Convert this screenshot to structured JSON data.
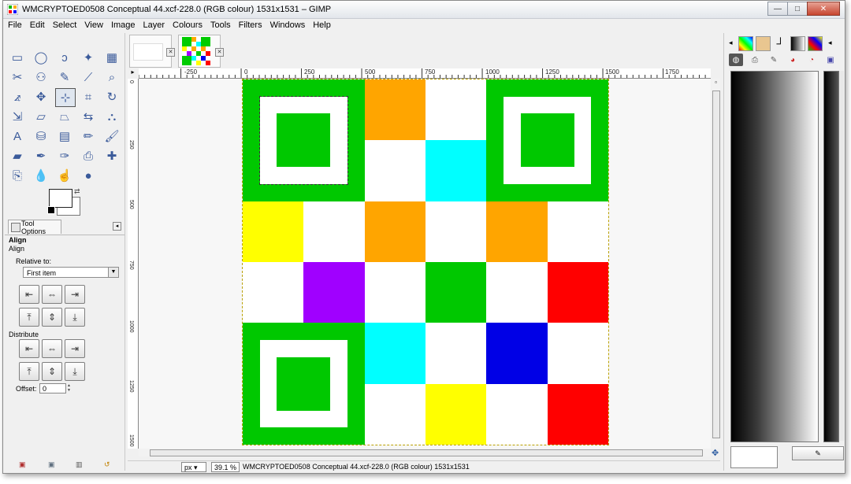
{
  "window": {
    "title": "WMCRYPTOED0508 Conceptual 44.xcf-228.0 (RGB colour) 1531x1531 – GIMP",
    "buttons": {
      "minimize": "—",
      "maximize": "□",
      "close": "✕"
    }
  },
  "menubar": {
    "items": [
      "File",
      "Edit",
      "Select",
      "View",
      "Image",
      "Layer",
      "Colours",
      "Tools",
      "Filters",
      "Windows",
      "Help"
    ]
  },
  "toolbox": {
    "tools": [
      {
        "name": "rect-select-icon",
        "glyph": "▭"
      },
      {
        "name": "ellipse-select-icon",
        "glyph": "◯"
      },
      {
        "name": "free-select-icon",
        "glyph": "ↄ"
      },
      {
        "name": "fuzzy-select-icon",
        "glyph": "✦"
      },
      {
        "name": "color-select-icon",
        "glyph": "▦"
      },
      {
        "name": "scissors-icon",
        "glyph": "✂"
      },
      {
        "name": "foreground-select-icon",
        "glyph": "⚇"
      },
      {
        "name": "paths-icon",
        "glyph": "✎"
      },
      {
        "name": "color-picker-icon",
        "glyph": "⟋"
      },
      {
        "name": "zoom-icon",
        "glyph": "⌕"
      },
      {
        "name": "measure-icon",
        "glyph": "⦨"
      },
      {
        "name": "move-icon",
        "glyph": "✥"
      },
      {
        "name": "align-icon",
        "glyph": "⊹"
      },
      {
        "name": "crop-icon",
        "glyph": "⌗"
      },
      {
        "name": "rotate-icon",
        "glyph": "↻"
      },
      {
        "name": "scale-icon",
        "glyph": "⇲"
      },
      {
        "name": "shear-icon",
        "glyph": "▱"
      },
      {
        "name": "perspective-icon",
        "glyph": "⏢"
      },
      {
        "name": "flip-icon",
        "glyph": "⇆"
      },
      {
        "name": "cage-icon",
        "glyph": "⛬"
      },
      {
        "name": "text-icon",
        "glyph": "A"
      },
      {
        "name": "bucket-fill-icon",
        "glyph": "⛁"
      },
      {
        "name": "blend-icon",
        "glyph": "▤"
      },
      {
        "name": "pencil-icon",
        "glyph": "✏"
      },
      {
        "name": "paintbrush-icon",
        "glyph": "🖌"
      },
      {
        "name": "eraser-icon",
        "glyph": "▰"
      },
      {
        "name": "airbrush-icon",
        "glyph": "✒"
      },
      {
        "name": "ink-icon",
        "glyph": "✑"
      },
      {
        "name": "clone-icon",
        "glyph": "⎙"
      },
      {
        "name": "heal-icon",
        "glyph": "✚"
      },
      {
        "name": "perspective-clone-icon",
        "glyph": "⎘"
      },
      {
        "name": "blur-icon",
        "glyph": "💧"
      },
      {
        "name": "smudge-icon",
        "glyph": "☝"
      },
      {
        "name": "dodge-burn-icon",
        "glyph": "●"
      }
    ],
    "tab_label": "Tool Options",
    "options": {
      "title": "Align",
      "subtitle": "Align",
      "relative_to_label": "Relative to:",
      "relative_to_value": "First item",
      "distribute_label": "Distribute",
      "offset_label": "Offset:",
      "offset_value": "0"
    },
    "align_buttons": [
      "⇤",
      "⇔",
      "⇥",
      "⤒",
      "⇕",
      "⤓"
    ],
    "distribute_buttons": [
      "⇤",
      "⇔",
      "⇥",
      "⤒",
      "⇕",
      "⤓"
    ]
  },
  "ruler": {
    "h_labels": [
      "-250",
      "0",
      "250",
      "500",
      "750",
      "1000",
      "1250",
      "1500",
      "1750"
    ],
    "v_labels": [
      "0",
      "250",
      "500",
      "750",
      "1000",
      "1250",
      "1500"
    ]
  },
  "statusbar": {
    "unit": "px",
    "zoom": "39.1 %",
    "text": "WMCRYPTOED0508 Conceptual 44.xcf-228.0 (RGB colour) 1531x1531"
  },
  "image": {
    "grid_size": 6,
    "colors": {
      "green": "#00c800",
      "orange": "#ffa500",
      "cyan": "#00ffff",
      "yellow": "#ffff00",
      "purple": "#a000ff",
      "red": "#ff0000",
      "blue": "#0000e6",
      "white": "#ffffff"
    },
    "cells": [
      [
        "F",
        "F",
        "orange",
        "white",
        "F",
        "F"
      ],
      [
        "F",
        "F",
        "white",
        "cyan",
        "F",
        "F"
      ],
      [
        "yellow",
        "white",
        "orange",
        "white",
        "orange",
        "white"
      ],
      [
        "white",
        "purple",
        "white",
        "green",
        "white",
        "red"
      ],
      [
        "F",
        "F",
        "cyan",
        "white",
        "blue",
        "white"
      ],
      [
        "F",
        "F",
        "white",
        "yellow",
        "white",
        "red"
      ]
    ]
  }
}
